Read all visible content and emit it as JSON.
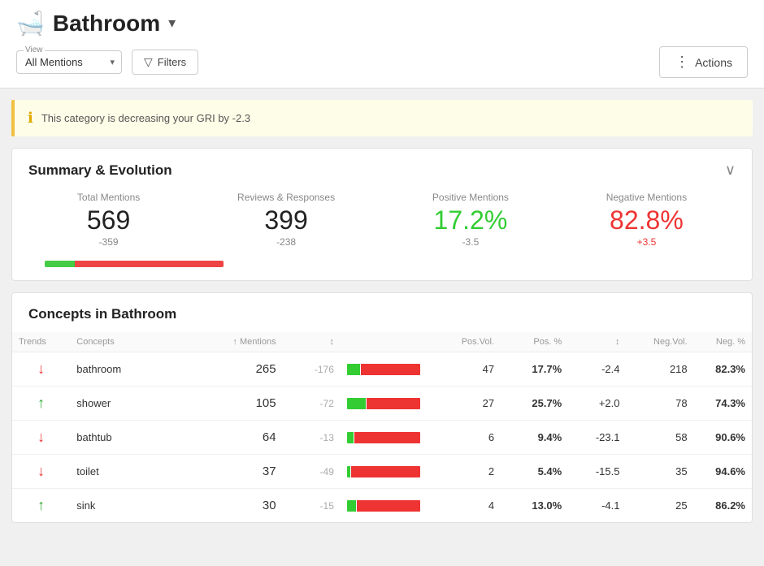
{
  "header": {
    "title": "Bathroom",
    "title_icon": "🛁",
    "dropdown_arrow": "▾",
    "view_label": "View",
    "view_value": "All Mentions",
    "filter_label": "Filters",
    "actions_label": "Actions"
  },
  "alert": {
    "text": "This category is decreasing your GRI by -2.3"
  },
  "summary": {
    "title": "Summary & Evolution",
    "stats": [
      {
        "label": "Total Mentions",
        "value": "569",
        "delta": "-359",
        "color": "normal",
        "delta_color": "normal"
      },
      {
        "label": "Reviews & Responses",
        "value": "399",
        "delta": "-238",
        "color": "normal",
        "delta_color": "normal"
      },
      {
        "label": "Positive Mentions",
        "value": "17.2%",
        "delta": "-3.5",
        "color": "green",
        "delta_color": "normal"
      },
      {
        "label": "Negative Mentions",
        "value": "82.8%",
        "delta": "+3.5",
        "color": "red",
        "delta_color": "red"
      }
    ],
    "progress_green_pct": 17,
    "progress_red_pct": 83
  },
  "concepts": {
    "title": "Concepts in Bathroom",
    "columns": {
      "trends": "Trends",
      "concepts": "Concepts",
      "mentions": "↑ Mentions",
      "sort1": "↕",
      "pos_vol": "Pos.Vol.",
      "pos_pct": "Pos. %",
      "sort2": "↕",
      "neg_vol": "Neg.Vol.",
      "neg_pct": "Neg. %"
    },
    "rows": [
      {
        "trend": "down",
        "name": "bathroom",
        "mentions": "265",
        "delta1": "-176",
        "bar_green_pct": 18,
        "bar_red_pct": 82,
        "pos_vol": "47",
        "pos_pct": "17.7%",
        "delta2": "-2.4",
        "delta2_color": "gray",
        "neg_vol": "218",
        "neg_pct": "82.3%"
      },
      {
        "trend": "up",
        "name": "shower",
        "mentions": "105",
        "delta1": "-72",
        "bar_green_pct": 26,
        "bar_red_pct": 74,
        "pos_vol": "27",
        "pos_pct": "25.7%",
        "delta2": "+2.0",
        "delta2_color": "green",
        "neg_vol": "78",
        "neg_pct": "74.3%"
      },
      {
        "trend": "down",
        "name": "bathtub",
        "mentions": "64",
        "delta1": "-13",
        "bar_green_pct": 9,
        "bar_red_pct": 91,
        "pos_vol": "6",
        "pos_pct": "9.4%",
        "delta2": "-23.1",
        "delta2_color": "gray",
        "neg_vol": "58",
        "neg_pct": "90.6%"
      },
      {
        "trend": "down",
        "name": "toilet",
        "mentions": "37",
        "delta1": "-49",
        "bar_green_pct": 5,
        "bar_red_pct": 95,
        "pos_vol": "2",
        "pos_pct": "5.4%",
        "delta2": "-15.5",
        "delta2_color": "gray",
        "neg_vol": "35",
        "neg_pct": "94.6%"
      },
      {
        "trend": "up",
        "name": "sink",
        "mentions": "30",
        "delta1": "-15",
        "bar_green_pct": 13,
        "bar_red_pct": 87,
        "pos_vol": "4",
        "pos_pct": "13.0%",
        "delta2": "-4.1",
        "delta2_color": "gray",
        "neg_vol": "25",
        "neg_pct": "86.2%"
      }
    ]
  }
}
